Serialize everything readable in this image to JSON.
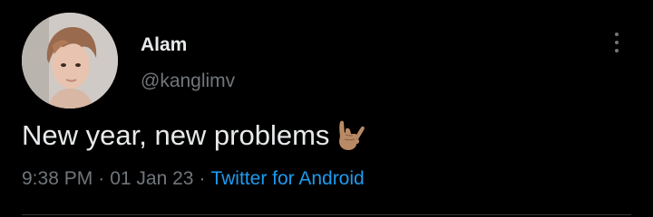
{
  "author": {
    "display_name": "Alam",
    "handle": "@kanglimv",
    "avatar_icon": "profile-photo"
  },
  "tweet": {
    "text": "New year, new problems",
    "emoji": "sign-of-the-horns-medium-skin-tone"
  },
  "meta": {
    "time": "9:38 PM",
    "separator": "·",
    "date": "01 Jan 23",
    "source": "Twitter for Android"
  },
  "menu": {
    "icon": "more-vertical-icon"
  },
  "colors": {
    "background": "#000000",
    "primary_text": "#e7e9ea",
    "secondary_text": "#71767b",
    "link": "#1d9bf0",
    "divider": "#2f3336"
  }
}
